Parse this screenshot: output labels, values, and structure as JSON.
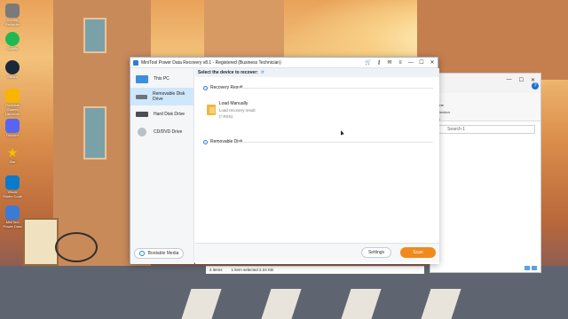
{
  "desktop": {
    "icons": [
      {
        "label": "Screen Recorder",
        "icon": "recorder-icon",
        "color": "#7a7a7a"
      },
      {
        "label": "Spotify",
        "icon": "spotify-icon",
        "color": "#1db954"
      },
      {
        "label": "Steam",
        "icon": "steam-icon",
        "color": "#1b2838"
      },
      {
        "label": "Rockstar Games Launcher",
        "icon": "rockstar-icon",
        "color": "#f7b500"
      },
      {
        "label": "Discord",
        "icon": "discord-icon",
        "color": "#5865f2"
      },
      {
        "label": "Star",
        "icon": "star-icon",
        "color": "#f2c200"
      },
      {
        "label": "Visual Studio Code",
        "icon": "vscode-icon",
        "color": "#0a7acc"
      },
      {
        "label": "MiniTool Power Data",
        "icon": "minitool-icon",
        "color": "#3a7bd5"
      }
    ]
  },
  "app": {
    "title": "MiniTool Power Data Recovery v8.1 - Registered (Business Technician)",
    "toolbar_icons": [
      "cart-icon",
      "key-icon",
      "mail-icon",
      "menu-icon"
    ],
    "window_controls": {
      "minimize": "—",
      "maximize": "☐",
      "close": "✕"
    },
    "sidebar": {
      "items": [
        {
          "label": "This PC",
          "icon": "monitor-icon",
          "color": "#3b8ee0"
        },
        {
          "label": "Removable Disk Drive",
          "icon": "usb-drive-icon",
          "color": "#6b7580"
        },
        {
          "label": "Hard Disk Drive",
          "icon": "hard-disk-icon",
          "color": "#4a4f55"
        },
        {
          "label": "CD/DVD Drive",
          "icon": "cd-dvd-icon",
          "color": "#b9c0c8"
        }
      ],
      "active_index": 1,
      "bootable_media_label": "Bootable Media"
    },
    "main": {
      "header": "Select the device to recover:",
      "sections": {
        "recovery_result": "Recovery Result",
        "removable_disk": "Removable Disk"
      },
      "load_manually": {
        "title": "Load Manually",
        "subtitle": "Load recovery result (*.RSS)"
      }
    },
    "footer": {
      "settings_label": "Settings",
      "scan_label": "Scan"
    }
  },
  "explorer": {
    "controls": {
      "minimize": "—",
      "maximize": "☐",
      "close": "✕"
    },
    "ribbon_items": [
      "all",
      "none",
      "selection",
      "ert"
    ],
    "search_placeholder": "Search 1",
    "help_label": "?",
    "status": {
      "items": "4 items",
      "selected": "1 item selected  2.24 KB"
    }
  }
}
